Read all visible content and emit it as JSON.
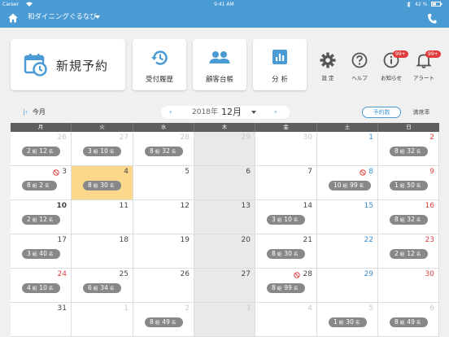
{
  "status_bar": {
    "carrier": "Career",
    "time": "9:41 AM",
    "battery": "42 %"
  },
  "nav": {
    "shop_name": "和ダイニングぐるなび"
  },
  "cards": {
    "new_reservation": "新規予約",
    "reception_history": "受付履歴",
    "customer_ledger": "顧客台帳",
    "analysis": "分 析"
  },
  "tools": {
    "settings": "設 定",
    "help": "ヘルプ",
    "notices": "お知らせ",
    "notices_badge": "99+",
    "alerts": "アラート",
    "alerts_badge": "99+"
  },
  "calendar_header": {
    "today": "今月",
    "year": "2018年",
    "month": "12月",
    "toggle_reservations": "予約数",
    "toggle_occupancy": "満席率"
  },
  "weekdays": [
    "月",
    "火",
    "水",
    "木",
    "金",
    "土",
    "日"
  ],
  "group_unit": "組",
  "person_unit": "名",
  "weeks": [
    [
      {
        "day": "26",
        "state": "other",
        "groups": "2",
        "people": "12"
      },
      {
        "day": "27",
        "state": "other",
        "groups": "3",
        "people": "10"
      },
      {
        "day": "28",
        "state": "other",
        "groups": "8",
        "people": "32"
      },
      {
        "day": "29",
        "state": "other-dim"
      },
      {
        "day": "30",
        "state": "other"
      },
      {
        "day": "1",
        "state": "sat"
      },
      {
        "day": "2",
        "state": "sun",
        "groups": "8",
        "people": "32"
      }
    ],
    [
      {
        "day": "3",
        "state": "normal",
        "closed": true,
        "groups": "8",
        "people": "2"
      },
      {
        "day": "4",
        "state": "today",
        "groups": "8",
        "people": "30"
      },
      {
        "day": "5",
        "state": "normal"
      },
      {
        "day": "6",
        "state": "dim"
      },
      {
        "day": "7",
        "state": "normal"
      },
      {
        "day": "8",
        "state": "sat",
        "closed": true,
        "groups": "10",
        "people": "99"
      },
      {
        "day": "9",
        "state": "sun",
        "groups": "1",
        "people": "50"
      }
    ],
    [
      {
        "day": "10",
        "state": "bold",
        "groups": "2",
        "people": "12"
      },
      {
        "day": "11",
        "state": "normal"
      },
      {
        "day": "12",
        "state": "normal"
      },
      {
        "day": "13",
        "state": "dim"
      },
      {
        "day": "14",
        "state": "normal",
        "groups": "3",
        "people": "10"
      },
      {
        "day": "15",
        "state": "sat"
      },
      {
        "day": "16",
        "state": "sun",
        "groups": "8",
        "people": "32"
      }
    ],
    [
      {
        "day": "17",
        "state": "normal",
        "groups": "3",
        "people": "40"
      },
      {
        "day": "18",
        "state": "normal"
      },
      {
        "day": "19",
        "state": "normal"
      },
      {
        "day": "20",
        "state": "dim"
      },
      {
        "day": "21",
        "state": "normal",
        "groups": "8",
        "people": "30"
      },
      {
        "day": "22",
        "state": "sat"
      },
      {
        "day": "23",
        "state": "sun",
        "groups": "2",
        "people": "12"
      }
    ],
    [
      {
        "day": "24",
        "state": "sun",
        "groups": "4",
        "people": "10"
      },
      {
        "day": "25",
        "state": "normal",
        "groups": "6",
        "people": "34"
      },
      {
        "day": "26",
        "state": "normal"
      },
      {
        "day": "27",
        "state": "dim"
      },
      {
        "day": "28",
        "state": "normal",
        "closed": true,
        "groups": "8",
        "people": "99"
      },
      {
        "day": "29",
        "state": "sat"
      },
      {
        "day": "30",
        "state": "sun"
      }
    ],
    [
      {
        "day": "31",
        "state": "normal"
      },
      {
        "day": "1",
        "state": "other"
      },
      {
        "day": "2",
        "state": "other",
        "groups": "8",
        "people": "49"
      },
      {
        "day": "3",
        "state": "other-dim"
      },
      {
        "day": "4",
        "state": "other"
      },
      {
        "day": "5",
        "state": "other",
        "groups": "1",
        "people": "30"
      },
      {
        "day": "6",
        "state": "other",
        "groups": "8",
        "people": "49"
      }
    ]
  ]
}
